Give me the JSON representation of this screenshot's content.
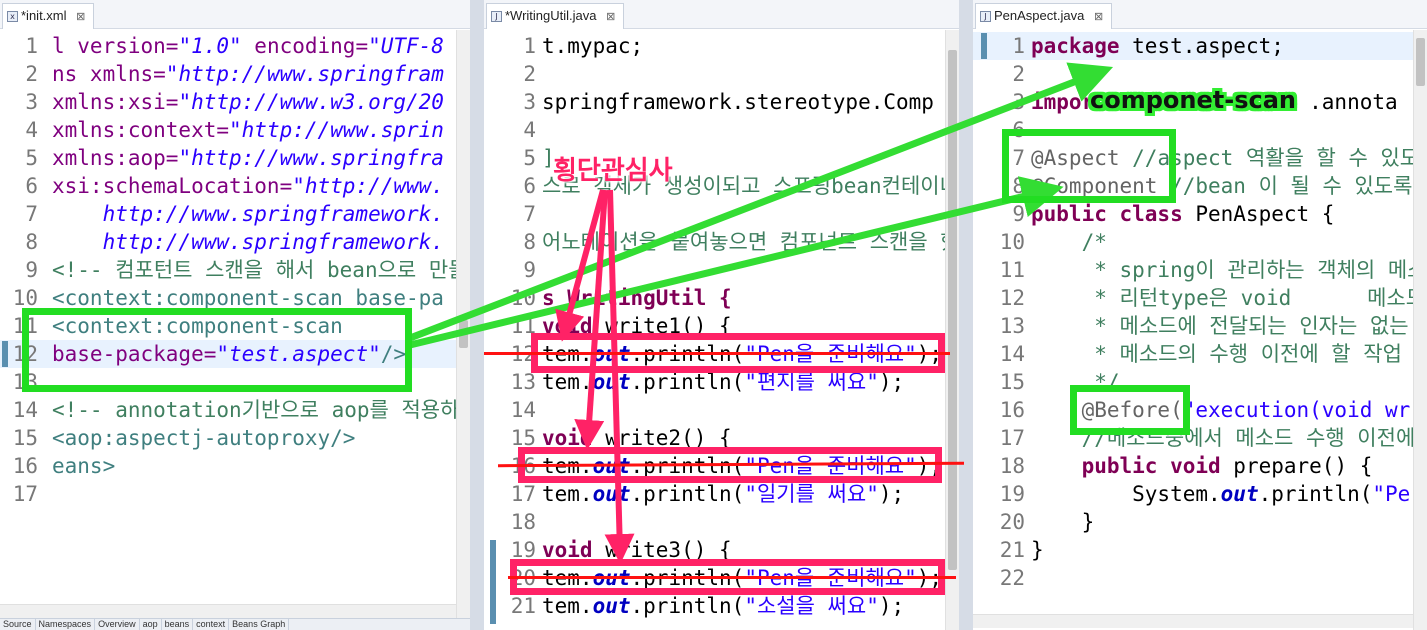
{
  "tabs": {
    "left": {
      "label": "*init.xml",
      "close": "⊠"
    },
    "middle": {
      "label": "*WritingUtil.java",
      "close": "⊠"
    },
    "right": {
      "label": "PenAspect.java",
      "close": "⊠"
    }
  },
  "left_editor": {
    "lines": [
      {
        "n": "1",
        "parts": [
          {
            "t": "l version=",
            "c": "xa"
          },
          {
            "t": "\"1.0\"",
            "c": "si"
          },
          {
            "t": " encoding=",
            "c": "xa"
          },
          {
            "t": "\"UTF-8",
            "c": "si"
          }
        ]
      },
      {
        "n": "2",
        "parts": [
          {
            "t": "ns xmlns=",
            "c": "xa"
          },
          {
            "t": "\"http://www.springfram",
            "c": "si"
          }
        ]
      },
      {
        "n": "3",
        "parts": [
          {
            "t": "xmlns:xsi=",
            "c": "xa"
          },
          {
            "t": "\"http://www.w3.org/20",
            "c": "si"
          }
        ]
      },
      {
        "n": "4",
        "parts": [
          {
            "t": "xmlns:context=",
            "c": "xa"
          },
          {
            "t": "\"http://www.sprin",
            "c": "si"
          }
        ]
      },
      {
        "n": "5",
        "parts": [
          {
            "t": "xmlns:aop=",
            "c": "xa"
          },
          {
            "t": "\"http://www.springfra",
            "c": "si"
          }
        ]
      },
      {
        "n": "6",
        "parts": [
          {
            "t": "xsi:schemaLocation=",
            "c": "xa"
          },
          {
            "t": "\"http://www.",
            "c": "si"
          }
        ]
      },
      {
        "n": "7",
        "parts": [
          {
            "t": "    http://www.springframework.",
            "c": "si"
          }
        ]
      },
      {
        "n": "8",
        "parts": [
          {
            "t": "    http://www.springframework.",
            "c": "si"
          }
        ]
      },
      {
        "n": "9",
        "parts": [
          {
            "t": "<!-- 컴포턴트 스캔을 해서 bean으로 만들",
            "c": "c"
          }
        ]
      },
      {
        "n": "10",
        "parts": [
          {
            "t": "<context:component-scan base-pa",
            "c": "x"
          }
        ]
      },
      {
        "n": "11",
        "parts": [
          {
            "t": "<context:component-scan",
            "c": "x"
          }
        ]
      },
      {
        "n": "12",
        "parts": [
          {
            "t": "base-package=",
            "c": "xa"
          },
          {
            "t": "\"test.aspect\"",
            "c": "si"
          },
          {
            "t": "/>",
            "c": "x"
          }
        ]
      },
      {
        "n": "13",
        "parts": [
          {
            "t": "",
            "c": ""
          }
        ]
      },
      {
        "n": "14",
        "parts": [
          {
            "t": "<!-- annotation기반으로 aop를 적용하",
            "c": "c"
          }
        ]
      },
      {
        "n": "15",
        "parts": [
          {
            "t": "<aop:aspectj-autoproxy/>",
            "c": "x"
          }
        ]
      },
      {
        "n": "16",
        "parts": [
          {
            "t": "eans>",
            "c": "x"
          }
        ]
      },
      {
        "n": "17",
        "parts": [
          {
            "t": "",
            "c": ""
          }
        ]
      }
    ]
  },
  "middle_editor": {
    "lines": [
      {
        "n": "1",
        "parts": [
          {
            "t": "t.mypac;",
            "c": ""
          }
        ]
      },
      {
        "n": "2",
        "parts": [
          {
            "t": "",
            "c": ""
          }
        ]
      },
      {
        "n": "3",
        "parts": [
          {
            "t": "springframework.stereotype.Comp",
            "c": ""
          }
        ]
      },
      {
        "n": "4",
        "parts": [
          {
            "t": "",
            "c": ""
          }
        ]
      },
      {
        "n": "5",
        "parts": [
          {
            "t": "]",
            "c": "c"
          }
        ]
      },
      {
        "n": "6",
        "parts": [
          {
            "t": "스로 객체가 생성이되고 스프링bean컨테이너에",
            "c": "c"
          }
        ]
      },
      {
        "n": "7",
        "parts": [
          {
            "t": "",
            "c": ""
          }
        ]
      },
      {
        "n": "8",
        "parts": [
          {
            "t": "어노테이션을 붙여놓으면 컴포넌트 스캔을 했을",
            "c": "c"
          }
        ]
      },
      {
        "n": "9",
        "parts": [
          {
            "t": "",
            "c": ""
          }
        ]
      },
      {
        "n": "10",
        "parts": [
          {
            "t": "s WritingUtil {",
            "c": "k"
          }
        ]
      },
      {
        "n": "11",
        "parts": [
          {
            "t": "void",
            "c": "k"
          },
          {
            "t": " write1() {",
            "c": ""
          }
        ]
      },
      {
        "n": "12",
        "parts": [
          {
            "t": "tem.",
            "c": ""
          },
          {
            "t": "out",
            "c": "f"
          },
          {
            "t": ".println(",
            "c": ""
          },
          {
            "t": "\"Pen을 준비해요\"",
            "c": "s"
          },
          {
            "t": ");",
            "c": ""
          }
        ]
      },
      {
        "n": "13",
        "parts": [
          {
            "t": "tem.",
            "c": ""
          },
          {
            "t": "out",
            "c": "f"
          },
          {
            "t": ".println(",
            "c": ""
          },
          {
            "t": "\"편지를 써요\"",
            "c": "s"
          },
          {
            "t": ");",
            "c": ""
          }
        ]
      },
      {
        "n": "14",
        "parts": [
          {
            "t": "",
            "c": ""
          }
        ]
      },
      {
        "n": "15",
        "parts": [
          {
            "t": "void",
            "c": "k"
          },
          {
            "t": " write2() {",
            "c": ""
          }
        ]
      },
      {
        "n": "16",
        "parts": [
          {
            "t": "tem.",
            "c": ""
          },
          {
            "t": "out",
            "c": "f"
          },
          {
            "t": ".println(",
            "c": ""
          },
          {
            "t": "\"Pen을 준비해요\"",
            "c": "s"
          },
          {
            "t": ");",
            "c": ""
          }
        ]
      },
      {
        "n": "17",
        "parts": [
          {
            "t": "tem.",
            "c": ""
          },
          {
            "t": "out",
            "c": "f"
          },
          {
            "t": ".println(",
            "c": ""
          },
          {
            "t": "\"일기를 써요\"",
            "c": "s"
          },
          {
            "t": ");",
            "c": ""
          }
        ]
      },
      {
        "n": "18",
        "parts": [
          {
            "t": "",
            "c": ""
          }
        ]
      },
      {
        "n": "19",
        "parts": [
          {
            "t": "void",
            "c": "k"
          },
          {
            "t": " write3() {",
            "c": ""
          }
        ]
      },
      {
        "n": "20",
        "parts": [
          {
            "t": "tem.",
            "c": ""
          },
          {
            "t": "out",
            "c": "f"
          },
          {
            "t": ".println(",
            "c": ""
          },
          {
            "t": "\"Pen을 준비해요\"",
            "c": "s"
          },
          {
            "t": ");",
            "c": ""
          }
        ]
      },
      {
        "n": "21",
        "parts": [
          {
            "t": "tem.",
            "c": ""
          },
          {
            "t": "out",
            "c": "f"
          },
          {
            "t": ".println(",
            "c": ""
          },
          {
            "t": "\"소설을 써요\"",
            "c": "s"
          },
          {
            "t": ");",
            "c": ""
          }
        ]
      }
    ]
  },
  "right_editor": {
    "lines": [
      {
        "n": "1",
        "parts": [
          {
            "t": "package",
            "c": "k"
          },
          {
            "t": " test.aspect;",
            "c": ""
          }
        ]
      },
      {
        "n": "2",
        "parts": [
          {
            "t": "",
            "c": ""
          }
        ]
      },
      {
        "n": "3",
        "parts": [
          {
            "t": "impor",
            "c": "k"
          },
          {
            "t": "                 .annota",
            "c": ""
          }
        ]
      },
      {
        "n": "6",
        "parts": [
          {
            "t": "",
            "c": ""
          }
        ]
      },
      {
        "n": "7",
        "parts": [
          {
            "t": "@Aspect",
            "c": "a"
          },
          {
            "t": " //aspect 역활을 할 수 있도록",
            "c": "c"
          }
        ]
      },
      {
        "n": "8",
        "parts": [
          {
            "t": "@Component",
            "c": "a"
          },
          {
            "t": " //bean 이 될 수 있도록",
            "c": "c"
          }
        ]
      },
      {
        "n": "9",
        "parts": [
          {
            "t": "public class",
            "c": "k"
          },
          {
            "t": " PenAspect {",
            "c": ""
          }
        ]
      },
      {
        "n": "10",
        "parts": [
          {
            "t": "    /*",
            "c": "c"
          }
        ]
      },
      {
        "n": "11",
        "parts": [
          {
            "t": "     * spring이 관리하는 객체의 메소드",
            "c": "c"
          }
        ]
      },
      {
        "n": "12",
        "parts": [
          {
            "t": "     * 리턴type은 void      메소드명",
            "c": "c"
          }
        ]
      },
      {
        "n": "13",
        "parts": [
          {
            "t": "     * 메소드에 전달되는 인자는 없는",
            "c": "c"
          }
        ]
      },
      {
        "n": "14",
        "parts": [
          {
            "t": "     * 메소드의 수행 이전에 할 작업",
            "c": "c"
          }
        ]
      },
      {
        "n": "15",
        "parts": [
          {
            "t": "     */",
            "c": "c"
          }
        ]
      },
      {
        "n": "16",
        "parts": [
          {
            "t": "    @Before(",
            "c": "a"
          },
          {
            "t": "\"execution(void wr",
            "c": "s"
          }
        ]
      },
      {
        "n": "17",
        "parts": [
          {
            "t": "    //메소드중에서 메소드 수행 이전에 적",
            "c": "c"
          }
        ]
      },
      {
        "n": "18",
        "parts": [
          {
            "t": "    public void",
            "c": "k"
          },
          {
            "t": " prepare() {",
            "c": ""
          }
        ]
      },
      {
        "n": "19",
        "parts": [
          {
            "t": "        System.",
            "c": ""
          },
          {
            "t": "out",
            "c": "f"
          },
          {
            "t": ".println(",
            "c": ""
          },
          {
            "t": "\"Pe",
            "c": "s"
          }
        ]
      },
      {
        "n": "20",
        "parts": [
          {
            "t": "    }",
            "c": ""
          }
        ]
      },
      {
        "n": "21",
        "parts": [
          {
            "t": "}",
            "c": ""
          }
        ]
      },
      {
        "n": "22",
        "parts": [
          {
            "t": "",
            "c": ""
          }
        ]
      }
    ]
  },
  "bottom_tabs": [
    "Source",
    "Namespaces",
    "Overview",
    "aop",
    "beans",
    "context",
    "Beans Graph"
  ],
  "annotations": {
    "cross_cutting_label": "횡단관심사",
    "component_scan_label": "componet-scan"
  },
  "colors": {
    "highlight_green": "#22dd22",
    "highlight_red": "#ff2266",
    "arrow_green": "#33dd33",
    "arrow_red": "#ff2266",
    "strike_red": "#ff1111"
  }
}
